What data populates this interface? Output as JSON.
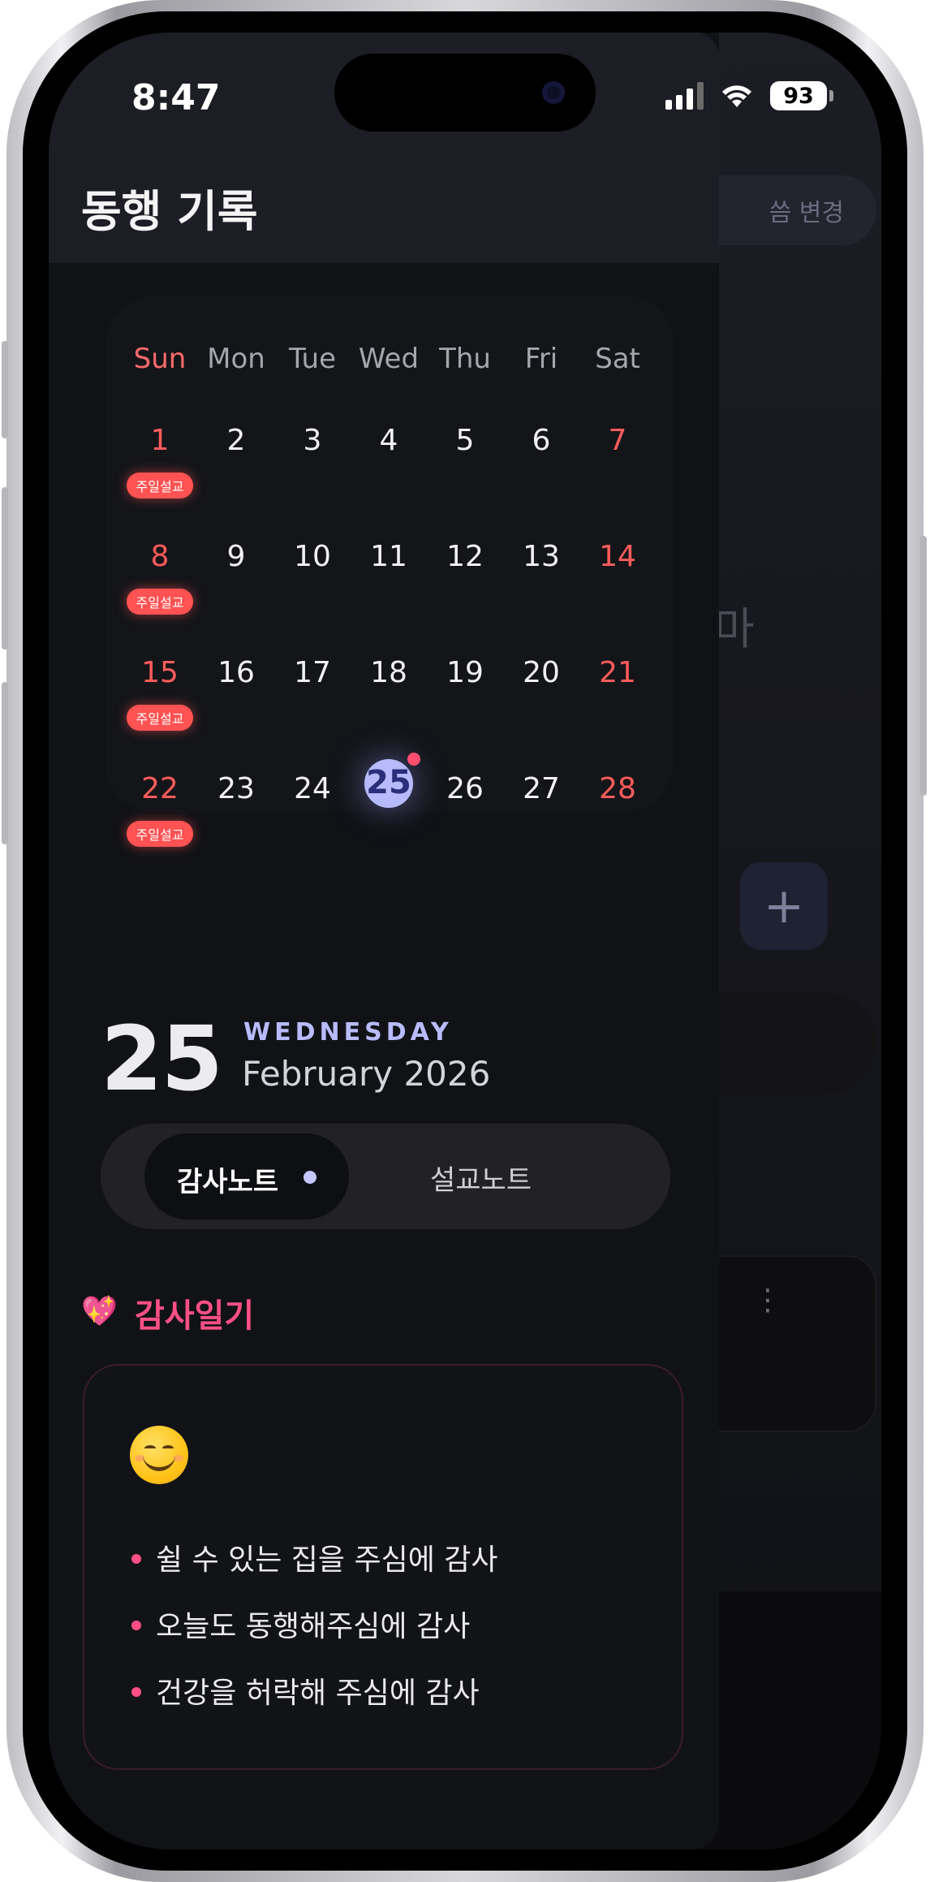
{
  "status_bar": {
    "time": "8:47",
    "battery": "93"
  },
  "background_app": {
    "button_label": "씀 변경",
    "partial_text": "마",
    "plus_label": "+",
    "more_label": "⋮"
  },
  "drawer": {
    "title": "동행 기록"
  },
  "calendar": {
    "weekdays": [
      "Sun",
      "Mon",
      "Tue",
      "Wed",
      "Thu",
      "Fri",
      "Sat"
    ],
    "weeks": [
      [
        "1",
        "2",
        "3",
        "4",
        "5",
        "6",
        "7"
      ],
      [
        "8",
        "9",
        "10",
        "11",
        "12",
        "13",
        "14"
      ],
      [
        "15",
        "16",
        "17",
        "18",
        "19",
        "20",
        "21"
      ],
      [
        "22",
        "23",
        "24",
        "25",
        "26",
        "27",
        "28"
      ]
    ],
    "sunday_badge": "주일설교",
    "selected_day": "25",
    "colors": {
      "weekend": "#ff5b5b",
      "selected": "#b8bbfb",
      "badge": "#ff5252",
      "dot": "#ff4d6d"
    }
  },
  "selected_date": {
    "day": "25",
    "weekday": "WEDNESDAY",
    "month_year": "February 2026"
  },
  "tabs": {
    "active": "감사노트",
    "inactive": "설교노트"
  },
  "section": {
    "icon": "💖",
    "title": "감사일기"
  },
  "note": {
    "emoji": "smiling-face-icon",
    "items": [
      "쉴 수 있는 집을 주심에 감사",
      "오늘도 동행해주심에 감사",
      "건강을 허락해 주심에 감사"
    ]
  }
}
